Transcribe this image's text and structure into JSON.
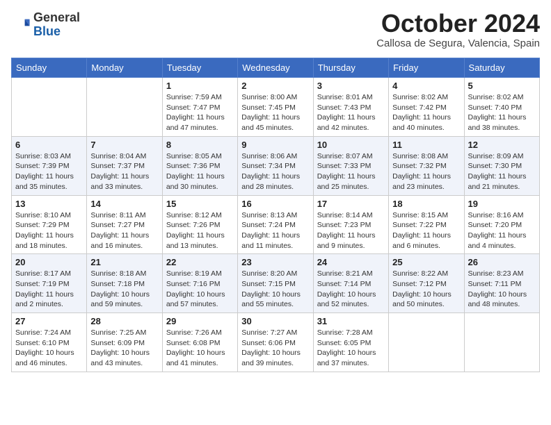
{
  "header": {
    "logo_general": "General",
    "logo_blue": "Blue",
    "title": "October 2024",
    "location": "Callosa de Segura, Valencia, Spain"
  },
  "weekdays": [
    "Sunday",
    "Monday",
    "Tuesday",
    "Wednesday",
    "Thursday",
    "Friday",
    "Saturday"
  ],
  "weeks": [
    [
      {
        "day": "",
        "info": ""
      },
      {
        "day": "",
        "info": ""
      },
      {
        "day": "1",
        "info": "Sunrise: 7:59 AM\nSunset: 7:47 PM\nDaylight: 11 hours and 47 minutes."
      },
      {
        "day": "2",
        "info": "Sunrise: 8:00 AM\nSunset: 7:45 PM\nDaylight: 11 hours and 45 minutes."
      },
      {
        "day": "3",
        "info": "Sunrise: 8:01 AM\nSunset: 7:43 PM\nDaylight: 11 hours and 42 minutes."
      },
      {
        "day": "4",
        "info": "Sunrise: 8:02 AM\nSunset: 7:42 PM\nDaylight: 11 hours and 40 minutes."
      },
      {
        "day": "5",
        "info": "Sunrise: 8:02 AM\nSunset: 7:40 PM\nDaylight: 11 hours and 38 minutes."
      }
    ],
    [
      {
        "day": "6",
        "info": "Sunrise: 8:03 AM\nSunset: 7:39 PM\nDaylight: 11 hours and 35 minutes."
      },
      {
        "day": "7",
        "info": "Sunrise: 8:04 AM\nSunset: 7:37 PM\nDaylight: 11 hours and 33 minutes."
      },
      {
        "day": "8",
        "info": "Sunrise: 8:05 AM\nSunset: 7:36 PM\nDaylight: 11 hours and 30 minutes."
      },
      {
        "day": "9",
        "info": "Sunrise: 8:06 AM\nSunset: 7:34 PM\nDaylight: 11 hours and 28 minutes."
      },
      {
        "day": "10",
        "info": "Sunrise: 8:07 AM\nSunset: 7:33 PM\nDaylight: 11 hours and 25 minutes."
      },
      {
        "day": "11",
        "info": "Sunrise: 8:08 AM\nSunset: 7:32 PM\nDaylight: 11 hours and 23 minutes."
      },
      {
        "day": "12",
        "info": "Sunrise: 8:09 AM\nSunset: 7:30 PM\nDaylight: 11 hours and 21 minutes."
      }
    ],
    [
      {
        "day": "13",
        "info": "Sunrise: 8:10 AM\nSunset: 7:29 PM\nDaylight: 11 hours and 18 minutes."
      },
      {
        "day": "14",
        "info": "Sunrise: 8:11 AM\nSunset: 7:27 PM\nDaylight: 11 hours and 16 minutes."
      },
      {
        "day": "15",
        "info": "Sunrise: 8:12 AM\nSunset: 7:26 PM\nDaylight: 11 hours and 13 minutes."
      },
      {
        "day": "16",
        "info": "Sunrise: 8:13 AM\nSunset: 7:24 PM\nDaylight: 11 hours and 11 minutes."
      },
      {
        "day": "17",
        "info": "Sunrise: 8:14 AM\nSunset: 7:23 PM\nDaylight: 11 hours and 9 minutes."
      },
      {
        "day": "18",
        "info": "Sunrise: 8:15 AM\nSunset: 7:22 PM\nDaylight: 11 hours and 6 minutes."
      },
      {
        "day": "19",
        "info": "Sunrise: 8:16 AM\nSunset: 7:20 PM\nDaylight: 11 hours and 4 minutes."
      }
    ],
    [
      {
        "day": "20",
        "info": "Sunrise: 8:17 AM\nSunset: 7:19 PM\nDaylight: 11 hours and 2 minutes."
      },
      {
        "day": "21",
        "info": "Sunrise: 8:18 AM\nSunset: 7:18 PM\nDaylight: 10 hours and 59 minutes."
      },
      {
        "day": "22",
        "info": "Sunrise: 8:19 AM\nSunset: 7:16 PM\nDaylight: 10 hours and 57 minutes."
      },
      {
        "day": "23",
        "info": "Sunrise: 8:20 AM\nSunset: 7:15 PM\nDaylight: 10 hours and 55 minutes."
      },
      {
        "day": "24",
        "info": "Sunrise: 8:21 AM\nSunset: 7:14 PM\nDaylight: 10 hours and 52 minutes."
      },
      {
        "day": "25",
        "info": "Sunrise: 8:22 AM\nSunset: 7:12 PM\nDaylight: 10 hours and 50 minutes."
      },
      {
        "day": "26",
        "info": "Sunrise: 8:23 AM\nSunset: 7:11 PM\nDaylight: 10 hours and 48 minutes."
      }
    ],
    [
      {
        "day": "27",
        "info": "Sunrise: 7:24 AM\nSunset: 6:10 PM\nDaylight: 10 hours and 46 minutes."
      },
      {
        "day": "28",
        "info": "Sunrise: 7:25 AM\nSunset: 6:09 PM\nDaylight: 10 hours and 43 minutes."
      },
      {
        "day": "29",
        "info": "Sunrise: 7:26 AM\nSunset: 6:08 PM\nDaylight: 10 hours and 41 minutes."
      },
      {
        "day": "30",
        "info": "Sunrise: 7:27 AM\nSunset: 6:06 PM\nDaylight: 10 hours and 39 minutes."
      },
      {
        "day": "31",
        "info": "Sunrise: 7:28 AM\nSunset: 6:05 PM\nDaylight: 10 hours and 37 minutes."
      },
      {
        "day": "",
        "info": ""
      },
      {
        "day": "",
        "info": ""
      }
    ]
  ]
}
